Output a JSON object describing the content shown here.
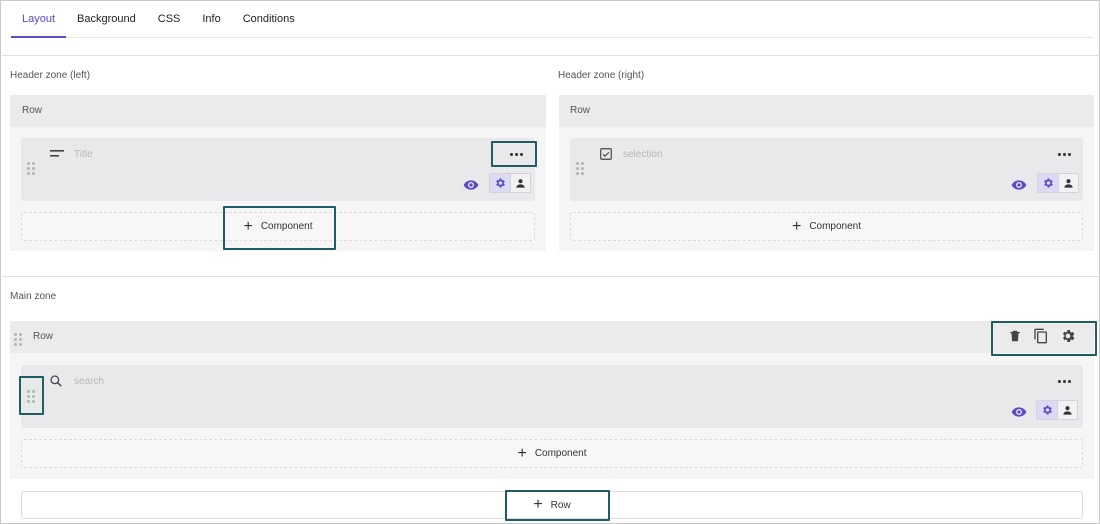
{
  "tabs": [
    {
      "label": "Layout",
      "active": true
    },
    {
      "label": "Background"
    },
    {
      "label": "CSS"
    },
    {
      "label": "Info"
    },
    {
      "label": "Conditions"
    }
  ],
  "header_left": {
    "zone_label": "Header zone (left)",
    "row_label": "Row",
    "component": {
      "icon": "short-text-icon",
      "name": "Title"
    },
    "add_component_label": "Component"
  },
  "header_right": {
    "zone_label": "Header zone (right)",
    "row_label": "Row",
    "component": {
      "icon": "checkbox-icon",
      "name": "selection"
    },
    "add_component_label": "Component"
  },
  "main": {
    "zone_label": "Main zone",
    "row_label": "Row",
    "row_tools": [
      "delete-icon",
      "copy-icon",
      "settings-icon"
    ],
    "component": {
      "icon": "search-icon",
      "name": "search"
    },
    "add_component_label": "Component",
    "add_row_label": "Row"
  },
  "colors": {
    "accent": "#5b4bc4",
    "highlight": "#1f5c66"
  }
}
